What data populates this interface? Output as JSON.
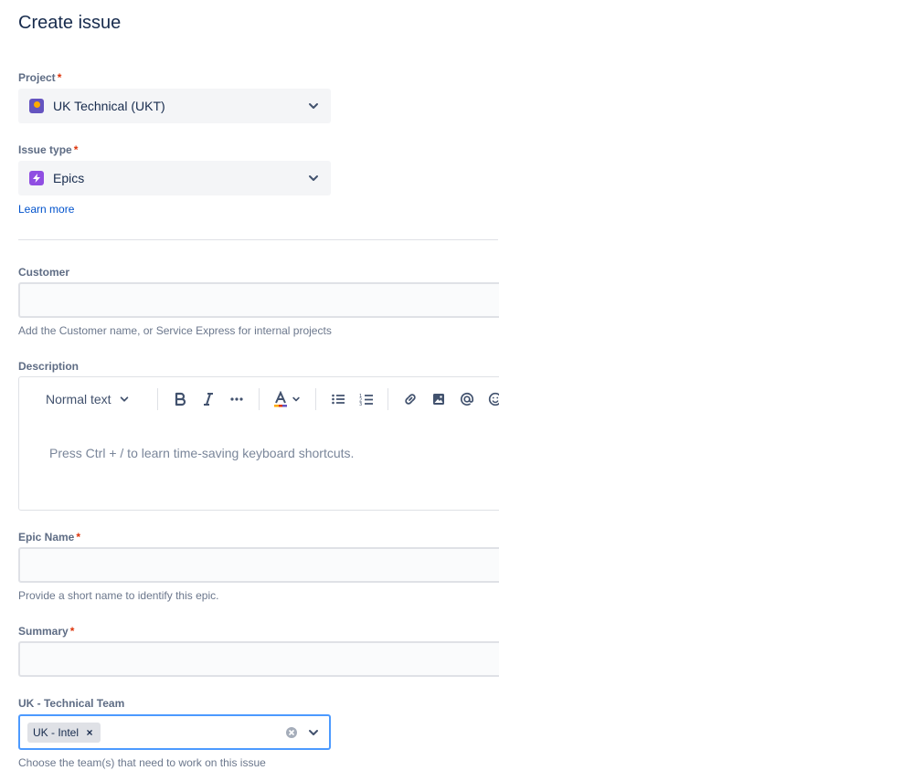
{
  "title": "Create issue",
  "project": {
    "label": "Project",
    "required_mark": "*",
    "value": "UK Technical (UKT)",
    "icon": "project-avatar-icon"
  },
  "issue_type": {
    "label": "Issue type",
    "required_mark": "*",
    "value": "Epics",
    "icon": "epic-icon"
  },
  "learn_more": "Learn more",
  "customer": {
    "label": "Customer",
    "value": "",
    "help": "Add the Customer name, or Service Express for internal projects"
  },
  "description": {
    "label": "Description",
    "text_style": "Normal text",
    "placeholder": "Press Ctrl + / to learn time-saving keyboard shortcuts.",
    "toolbar_icons": [
      "bold-icon",
      "italic-icon",
      "more-icon",
      "text-color-icon",
      "bullet-list-icon",
      "numbered-list-icon",
      "link-icon",
      "image-icon",
      "mention-icon",
      "emoji-icon"
    ]
  },
  "epic_name": {
    "label": "Epic Name",
    "required_mark": "*",
    "value": "",
    "help": "Provide a short name to identify this epic."
  },
  "summary": {
    "label": "Summary",
    "required_mark": "*",
    "value": ""
  },
  "team": {
    "label": "UK - Technical Team",
    "selected": [
      "UK - Intel"
    ],
    "remove_glyph": "×",
    "help": "Choose the team(s) that need to work on this issue"
  },
  "colors": {
    "accent": "#0052cc",
    "required": "#de350b",
    "focus": "#4c9aff",
    "field_bg": "#f4f5f7"
  }
}
